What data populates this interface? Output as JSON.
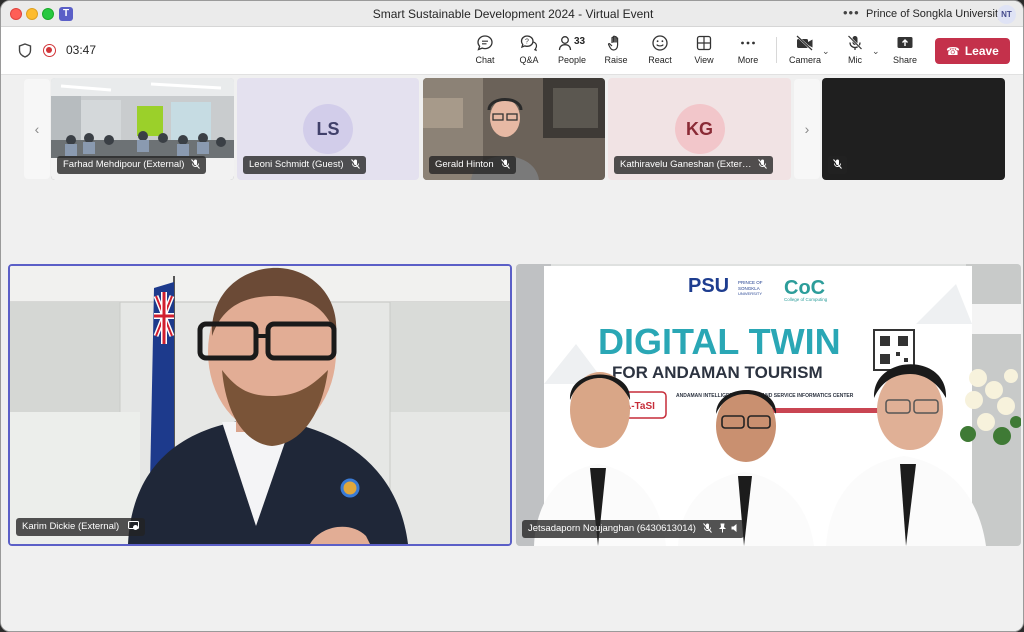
{
  "window": {
    "title": "Smart Sustainable Development 2024 - Virtual Event",
    "org": "Prince of Songkla University",
    "user_initials": "NT",
    "app_icon_letter": "T"
  },
  "meeting": {
    "timer": "03:47",
    "people_count": "33",
    "toolbar": {
      "chat": "Chat",
      "qa": "Q&A",
      "people": "People",
      "raise": "Raise",
      "react": "React",
      "view": "View",
      "more": "More",
      "camera": "Camera",
      "mic": "Mic",
      "share": "Share",
      "leave": "Leave"
    }
  },
  "strip": {
    "tiles": [
      {
        "name": "Farhad Mehdipour (External)",
        "type": "video"
      },
      {
        "name": "Leoni Schmidt (Guest)",
        "type": "initials",
        "initials": "LS"
      },
      {
        "name": "Gerald Hinton",
        "type": "video"
      },
      {
        "name": "Kathiravelu Ganeshan (Exter…",
        "type": "initials",
        "initials": "KG"
      },
      {
        "name": "",
        "type": "blank"
      }
    ]
  },
  "stage": {
    "left": {
      "name": "Karim Dickie (External)"
    },
    "right": {
      "name": "Jetsadaporn Noujanghan (6430613014)",
      "banner_brand": "PSU",
      "banner_brand_small_1": "PRINCE OF",
      "banner_brand_small_2": "SONGKLA",
      "banner_brand_small_3": "UNIVERSITY",
      "banner_coc": "CoC",
      "banner_coc_sub": "College of Computing",
      "banner_title": "DIGITAL TWIN",
      "banner_subtitle": "FOR ANDAMAN TOURISM",
      "banner_small_caps": "ANDAMAN INTELLIGENT TOURISM AND SERVICE INFORMATICS CENTER",
      "banner_logo": "A-TaSI"
    }
  },
  "colors": {
    "accent": "#5b5fc7",
    "leave": "#c4314b",
    "record": "#d13438"
  }
}
